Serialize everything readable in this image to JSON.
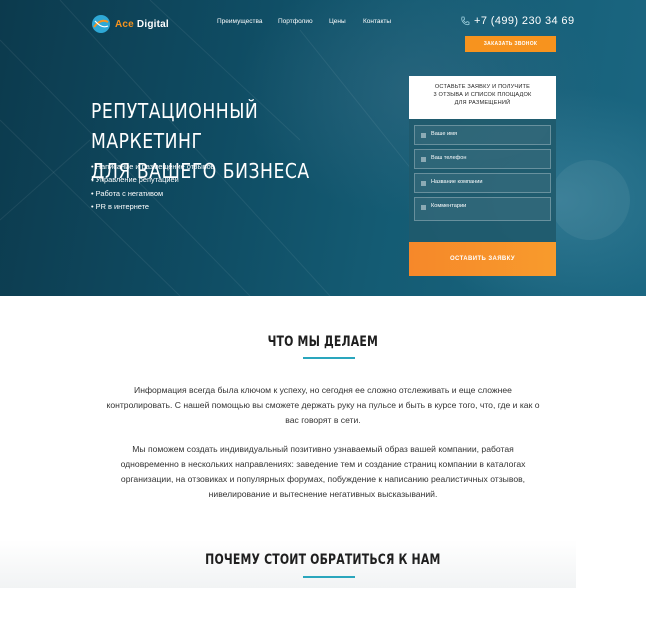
{
  "header": {
    "logo": {
      "name_part1": "Ace",
      "name_part2": " Digital"
    },
    "nav": [
      {
        "label": "Преимущества"
      },
      {
        "label": "Портфолио"
      },
      {
        "label": "Цены"
      },
      {
        "label": "Контакты"
      }
    ],
    "phone": "+7 (499) 230 34 69",
    "callback_button": "Заказать звонок"
  },
  "hero": {
    "title_line1": "Репутационный маркетинг",
    "title_line2": "для вашего бизнеса",
    "services": [
      "Написание и размещение отзывов",
      "Управление репутацией",
      "Работа с негативом",
      "PR в интернете"
    ]
  },
  "form": {
    "heading_line1": "Оставьте заявку и получите",
    "heading_line2": "3 отзыва и список площадок",
    "heading_line3": "для размещений",
    "fields": [
      {
        "placeholder": "Ваше имя"
      },
      {
        "placeholder": "Ваш телефон"
      },
      {
        "placeholder": "Название компании"
      },
      {
        "placeholder": "Комментарии"
      }
    ],
    "submit": "Оставить заявку"
  },
  "about": {
    "title": "Что мы делаем",
    "paragraph1_line1": "Информация всегда была ключом к успеху, но сегодня ее сложно отслеживать и еще сложнее",
    "paragraph1_line2": "контролировать. С нашей помощью вы сможете держать руку на пульсе и быть в курсе того, что, где и как о",
    "paragraph1_line3": "вас говорят в сети.",
    "paragraph2_line1": "Мы поможем создать индивидуальный позитивно узнаваемый образ вашей компании, работая",
    "paragraph2_line2": "одновременно в нескольких направлениях: заведение тем и создание страниц компании в каталогах",
    "paragraph2_line3": "организации, на отзовиках и популярных форумах, побуждение к написанию реалистичных отзывов,",
    "paragraph2_line4": "нивелирование и вытеснение негативных высказываний."
  },
  "why": {
    "title": "Почему стоит обратиться к нам"
  },
  "colors": {
    "accent_orange": "#f7931e",
    "accent_teal": "#2aa6bd",
    "hero_dark": "#0f4c63"
  },
  "icons": [
    "logo-mark-icon",
    "phone-icon",
    "field-icon"
  ]
}
